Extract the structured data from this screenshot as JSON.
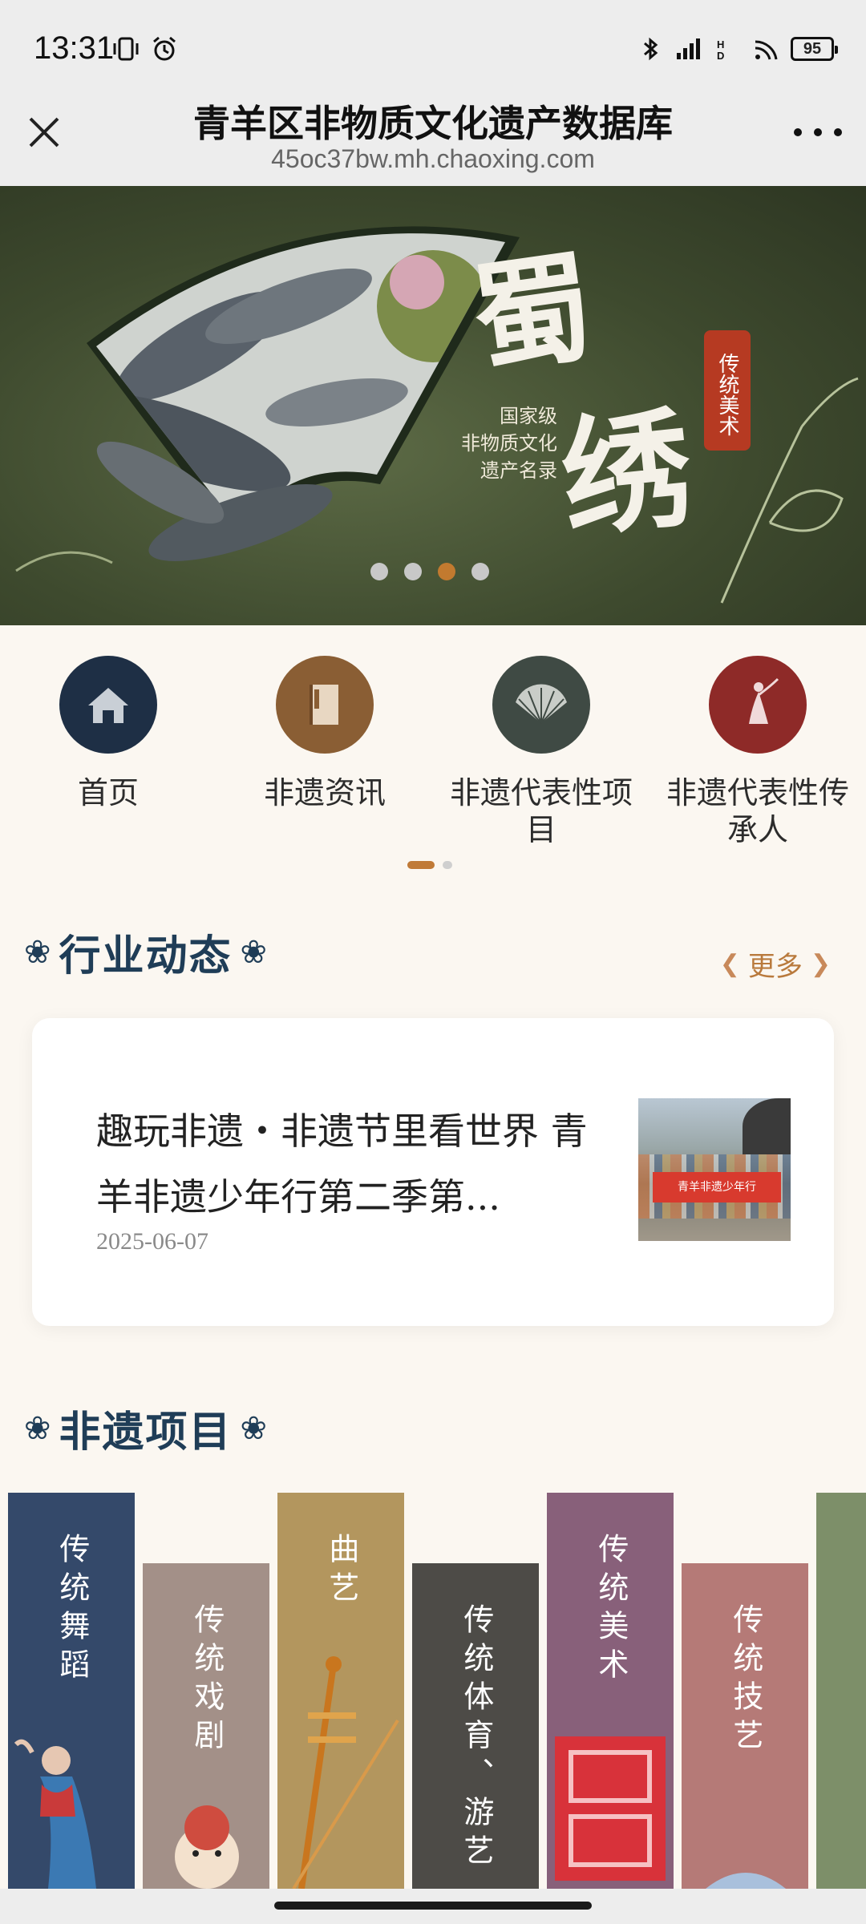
{
  "status_bar": {
    "time": "13:31",
    "battery": "95",
    "icons": [
      "vibrate-icon",
      "alarm-icon",
      "bluetooth-icon",
      "signal-icon",
      "hd-icon",
      "wifi-icon",
      "battery-icon"
    ]
  },
  "title_bar": {
    "title": "青羊区非物质文化遗产数据库",
    "url": "45oc37bw.mh.chaoxing.com",
    "close_icon": "close-icon",
    "more_icon": "more-icon"
  },
  "banner": {
    "title_char_1": "蜀",
    "title_char_2": "绣",
    "subtitle_lines": [
      "国家级",
      "非物质文化",
      "遗产名录"
    ],
    "badge": "传统美术",
    "dots": 4,
    "active_dot": 3
  },
  "nav": {
    "items": [
      {
        "label": "首页",
        "icon": "home-icon",
        "color": "#1e2f45"
      },
      {
        "label": "非遗资讯",
        "icon": "book-icon",
        "color": "#8a5e34"
      },
      {
        "label": "非遗代表性项目",
        "icon": "fan-icon",
        "color": "#3f4a44"
      },
      {
        "label": "非遗代表性传承人",
        "icon": "dancer-icon",
        "color": "#8e2a28"
      }
    ]
  },
  "section_news": {
    "title": "行业动态",
    "more": "更多"
  },
  "news": {
    "title": "趣玩非遗・非遗节里看世界 青羊非遗少年行第二季第...",
    "date": "2025-06-07",
    "thumb_banner": "青羊非遗少年行"
  },
  "section_projects": {
    "title": "非遗项目"
  },
  "categories": [
    {
      "label": "传统舞蹈",
      "color": "#34496a"
    },
    {
      "label": "传统戏剧",
      "color": "#a39088"
    },
    {
      "label": "曲艺",
      "color": "#b3965e"
    },
    {
      "label": "传统体育、游艺",
      "color": "#4d4b47"
    },
    {
      "label": "传统美术",
      "color": "#88607a"
    },
    {
      "label": "传统技艺",
      "color": "#b57a77"
    },
    {
      "label": "",
      "color": "#7d8f69"
    }
  ]
}
